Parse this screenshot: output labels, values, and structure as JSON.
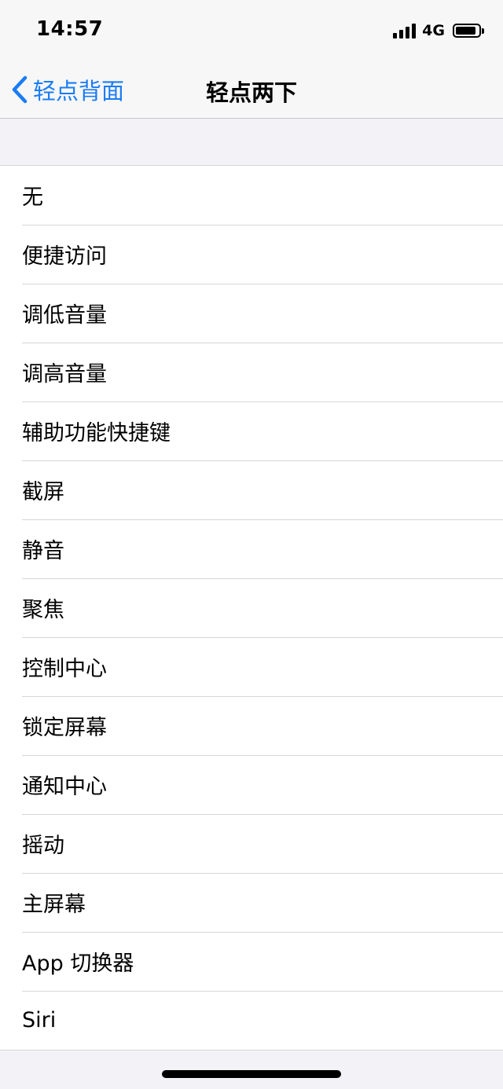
{
  "status": {
    "time": "14:57",
    "network": "4G",
    "signal_bars": 4,
    "battery_level": 0.9
  },
  "nav": {
    "back_label": "轻点背面",
    "title": "轻点两下"
  },
  "options": [
    {
      "label": "无"
    },
    {
      "label": "便捷访问"
    },
    {
      "label": "调低音量"
    },
    {
      "label": "调高音量"
    },
    {
      "label": "辅助功能快捷键"
    },
    {
      "label": "截屏"
    },
    {
      "label": "静音"
    },
    {
      "label": "聚焦"
    },
    {
      "label": "控制中心"
    },
    {
      "label": "锁定屏幕"
    },
    {
      "label": "通知中心"
    },
    {
      "label": "摇动"
    },
    {
      "label": "主屏幕"
    },
    {
      "label": "App 切换器"
    },
    {
      "label": "Siri"
    }
  ],
  "colors": {
    "accent": "#1a7cf5",
    "background": "#f2f2f7",
    "separator": "#d6d6d9"
  }
}
